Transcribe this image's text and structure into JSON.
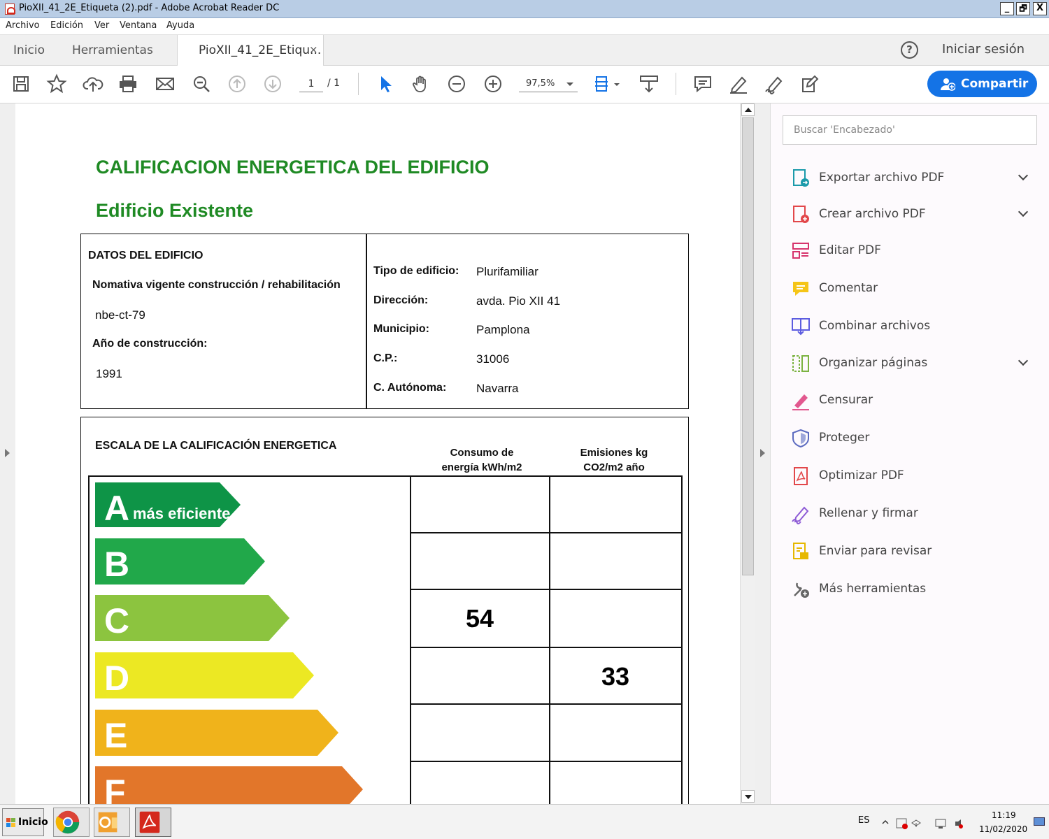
{
  "window": {
    "title": "PioXII_41_2E_Etiqueta (2).pdf - Adobe Acrobat Reader DC",
    "minimize": "_",
    "restore": "×",
    "close": "X"
  },
  "menu": [
    "Archivo",
    "Edición",
    "Ver",
    "Ventana",
    "Ayuda"
  ],
  "tabs": {
    "home": "Inicio",
    "tools": "Herramientas",
    "doc": "PioXII_41_2E_Etiqu...",
    "close": "×"
  },
  "header": {
    "help": "?",
    "signin": "Iniciar sesión"
  },
  "toolbar": {
    "page_current": "1",
    "page_total": "/ 1",
    "zoom": "97,5%",
    "share_label": "Compartir"
  },
  "sidebar": {
    "search_placeholder": "Buscar 'Encabezado'",
    "tools": [
      {
        "label": "Exportar archivo PDF",
        "icon": "export-pdf-icon",
        "expandable": true
      },
      {
        "label": "Crear archivo PDF",
        "icon": "create-pdf-icon",
        "expandable": true
      },
      {
        "label": "Editar PDF",
        "icon": "edit-pdf-icon",
        "expandable": false
      },
      {
        "label": "Comentar",
        "icon": "comment-icon",
        "expandable": false
      },
      {
        "label": "Combinar archivos",
        "icon": "combine-files-icon",
        "expandable": false
      },
      {
        "label": "Organizar páginas",
        "icon": "organize-pages-icon",
        "expandable": true
      },
      {
        "label": "Censurar",
        "icon": "redact-icon",
        "expandable": false
      },
      {
        "label": "Proteger",
        "icon": "protect-icon",
        "expandable": false
      },
      {
        "label": "Optimizar PDF",
        "icon": "optimize-pdf-icon",
        "expandable": false
      },
      {
        "label": "Rellenar y firmar",
        "icon": "fill-sign-icon",
        "expandable": false
      },
      {
        "label": "Enviar para revisar",
        "icon": "send-review-icon",
        "expandable": false
      },
      {
        "label": "Más herramientas",
        "icon": "more-tools-icon",
        "expandable": false
      }
    ]
  },
  "document": {
    "title": "CALIFICACION ENERGETICA DEL EDIFICIO",
    "subtitle": "Edificio Existente",
    "datos": {
      "heading": "DATOS DEL EDIFICIO",
      "normativa_label": "Nomativa vigente construcción / rehabilitación",
      "normativa_value": "nbe-ct-79",
      "anio_label": "Año de construcción:",
      "anio_value": "1991"
    },
    "info": [
      {
        "label": "Tipo de edificio:",
        "value": "Plurifamiliar"
      },
      {
        "label": "Dirección:",
        "value": "avda. Pio XII 41"
      },
      {
        "label": "Municipio:",
        "value": "Pamplona"
      },
      {
        "label": "C.P.:",
        "value": "31006"
      },
      {
        "label": "C. Autónoma:",
        "value": "Navarra"
      }
    ],
    "escala": {
      "heading": "ESCALA DE LA CALIFICACIÓN ENERGETICA",
      "col_consumo_1": "Consumo de",
      "col_consumo_2": "energía kWh/m2",
      "col_emisiones_1": "Emisiones kg",
      "col_emisiones_2": "CO2/m2 año",
      "a_suffix": "más eficiente",
      "grades": [
        {
          "letter": "A",
          "color": "#0e9447"
        },
        {
          "letter": "B",
          "color": "#21a84a"
        },
        {
          "letter": "C",
          "color": "#8cc43f"
        },
        {
          "letter": "D",
          "color": "#ece823"
        },
        {
          "letter": "E",
          "color": "#f0b31b"
        },
        {
          "letter": "F",
          "color": "#e2762a"
        }
      ],
      "consumo_value": "54",
      "emisiones_value": "33"
    }
  },
  "taskbar": {
    "start": "Inicio",
    "lang": "ES",
    "time": "11:19",
    "date": "11/02/2020"
  }
}
